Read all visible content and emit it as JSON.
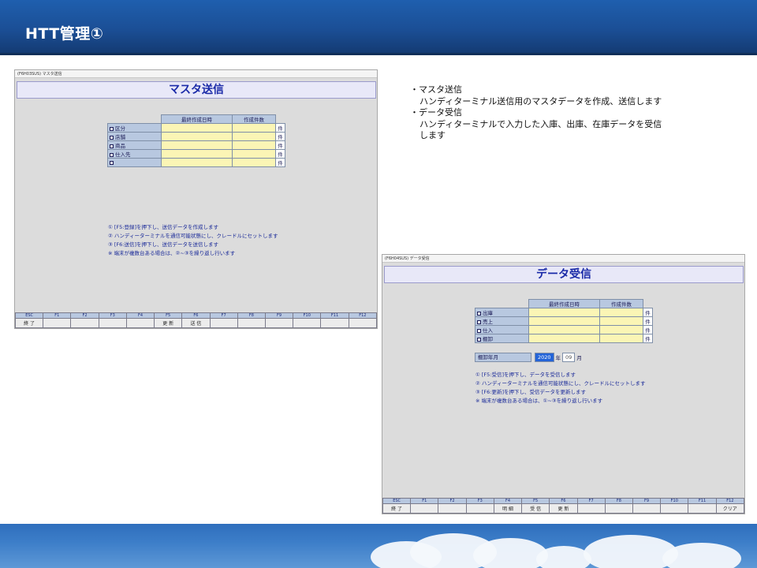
{
  "slide": {
    "title": "HTT管理①"
  },
  "master_window": {
    "caption": "(F6H03SUS) マスタ送信",
    "title": "マスタ送信",
    "table": {
      "headers": [
        "最終作成日時",
        "作成件数"
      ],
      "rows": [
        {
          "label": "区分",
          "unit": "件"
        },
        {
          "label": "店舗",
          "unit": "件"
        },
        {
          "label": "商品",
          "unit": "件"
        },
        {
          "label": "仕入先",
          "unit": "件"
        },
        {
          "label": "",
          "unit": "件"
        }
      ]
    },
    "instructions": [
      "① [F5:登録]を押下し、送信データを作成します",
      "② ハンディーターミナルを通信可能状態にし、クレードルにセットします",
      "③ [F6:送信]を押下し、送信データを送信します",
      "※ 端末が複数台ある場合は、②~③を繰り返し行います"
    ],
    "fkeys": {
      "keys": [
        "ESC",
        "F1",
        "F2",
        "F3",
        "F4",
        "F5",
        "F6",
        "F7",
        "F8",
        "F9",
        "F10",
        "F11",
        "F12"
      ],
      "labels": [
        "終 了",
        "",
        "",
        "",
        "",
        "更 新",
        "送 信",
        "",
        "",
        "",
        "",
        "",
        ""
      ]
    }
  },
  "receive_window": {
    "caption": "(F6H04SUS) データ受信",
    "title": "データ受信",
    "table": {
      "headers": [
        "最終作成日時",
        "作成件数"
      ],
      "rows": [
        {
          "label": "出庫",
          "unit": "件"
        },
        {
          "label": "売上",
          "unit": "件"
        },
        {
          "label": "仕入",
          "unit": "件"
        },
        {
          "label": "棚卸",
          "unit": "件"
        }
      ]
    },
    "year_month": {
      "label": "棚卸年月",
      "year": "2020",
      "year_unit": "年",
      "month": "09",
      "month_unit": "月"
    },
    "instructions": [
      "① [F5:受信]を押下し、データを受信します",
      "② ハンディーターミナルを通信可能状態にし、クレードルにセットします",
      "③ [F6:更新]を押下し、受信データを更新します",
      "※ 端末が複数台ある場合は、①~③を繰り返し行います"
    ],
    "fkeys": {
      "keys": [
        "ESC",
        "F1",
        "F2",
        "F3",
        "F4",
        "F5",
        "F6",
        "F7",
        "F8",
        "F9",
        "F10",
        "F11",
        "F12"
      ],
      "labels": [
        "終 了",
        "",
        "",
        "",
        "明 細",
        "受 信",
        "更 新",
        "",
        "",
        "",
        "",
        "",
        "クリア"
      ]
    }
  },
  "description": {
    "lines": [
      {
        "text": "・マスタ送信",
        "indent": false
      },
      {
        "text": "ハンディターミナル送信用のマスタデータを作成、送信します",
        "indent": true
      },
      {
        "text": "・データ受信",
        "indent": false
      },
      {
        "text": "ハンディターミナルで入力した入庫、出庫、在庫データを受信",
        "indent": true
      },
      {
        "text": "します",
        "indent": true
      }
    ]
  }
}
